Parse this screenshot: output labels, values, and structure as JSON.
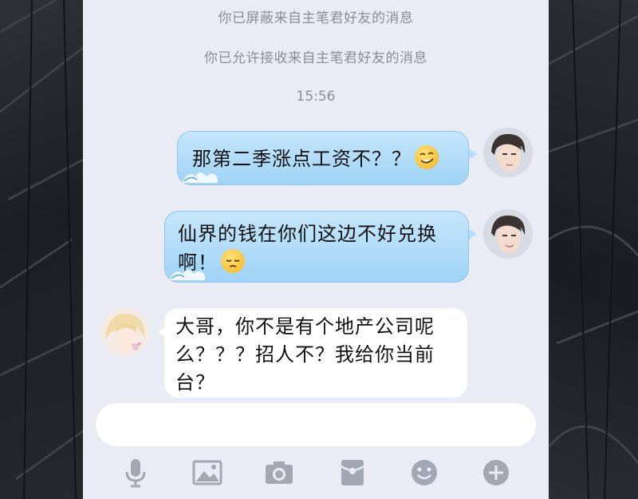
{
  "system_messages": [
    "你已屏蔽来自主笔君好友的消息",
    "你已允许接收来自主笔君好友的消息"
  ],
  "timestamp": "15:56",
  "messages": [
    {
      "side": "outgoing",
      "text": "那第二季涨点工资不？？",
      "emoji": "smirk-emoji"
    },
    {
      "side": "outgoing",
      "line1": "仙界的钱在你们这边不好兑换",
      "line2": "啊！",
      "emoji": "pensive-emoji"
    },
    {
      "side": "incoming",
      "line1": "大哥，你不是有个地产公司呢",
      "line2": "么？？？招人不？我给你当前",
      "line3": "台？"
    }
  ],
  "input": {
    "placeholder": ""
  },
  "toolbar": {
    "icons": [
      "microphone-icon",
      "image-icon",
      "camera-icon",
      "red-packet-icon",
      "emoji-icon",
      "plus-icon"
    ]
  },
  "colors": {
    "outgoing_bubble": "#a9d8f8",
    "incoming_bubble": "#ffffff",
    "chat_background": "#e9ecf5",
    "system_text": "#8a8e99",
    "toolbar_icon": "#a3a7b3"
  }
}
